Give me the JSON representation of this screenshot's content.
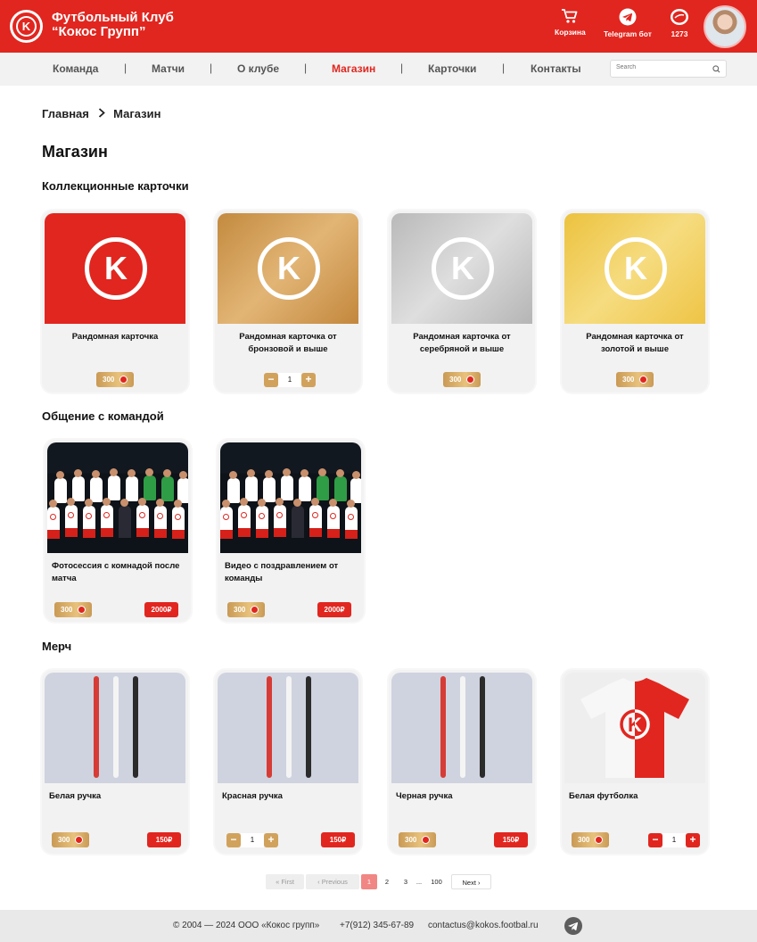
{
  "header": {
    "club_line1": "Футбольный Клуб",
    "club_line2": "“Кокос Групп”",
    "logo_letter": "K",
    "cart_label": "Корзина",
    "telegram_label": "Telegram бот",
    "coins_label": "1273"
  },
  "nav": {
    "items": [
      "Команда",
      "Матчи",
      "О клубе",
      "Магазин",
      "Карточки",
      "Контакты"
    ],
    "active": "Магазин",
    "separator": "|",
    "search_placeholder": "Search"
  },
  "breadcrumb": {
    "home": "Главная",
    "current": "Магазин"
  },
  "page_title": "Магазин",
  "sections": {
    "cards": "Коллекционные карточки",
    "team": "Общение с командой",
    "merch": "Мерч"
  },
  "collectible_cards": [
    {
      "name": "Рандомная карточка",
      "coins": "300",
      "color": "#e1261f"
    },
    {
      "name": "Рандомная карточка от бронзовой и выше",
      "quantity": "1",
      "color": "#c98f45"
    },
    {
      "name": "Рандомная карточка от серебряной и выше",
      "coins": "300",
      "color": "#bdbdbd"
    },
    {
      "name": "Рандомная карточка от золотой и выше",
      "coins": "300",
      "color": "#eec747"
    }
  ],
  "team_items": [
    {
      "name": "Фотосессия с комнадой после матча",
      "coins": "300",
      "price": "2000₽"
    },
    {
      "name": "Видео с поздравлением от команды",
      "coins": "300",
      "price": "2000₽"
    }
  ],
  "merch_items": [
    {
      "name": "Белая ручка",
      "coins": "300",
      "price": "150₽"
    },
    {
      "name": "Красная ручка",
      "quantity": "1",
      "price": "150₽"
    },
    {
      "name": "Черная ручка",
      "coins": "300",
      "price": "150₽"
    },
    {
      "name": "Белая футболка",
      "coins": "300",
      "quantity": "1"
    }
  ],
  "stepper": {
    "minus": "−",
    "plus": "+"
  },
  "pagination": {
    "first": "First",
    "previous": "Previous",
    "pages": [
      "1",
      "2",
      "3"
    ],
    "ellipsis": "...",
    "last_page": "100",
    "next": "Next",
    "current": "1"
  },
  "footer": {
    "copyright": "© 2004 — 2024 ООО «Кокос групп»",
    "phone": "+7(912) 345-67-89",
    "email": "contactus@kokos.footbal.ru"
  },
  "icons": [
    "cart-icon",
    "telegram-icon",
    "coin-icon",
    "search-icon",
    "chevron-right-icon",
    "double-chevron-left-icon",
    "chevron-left-icon"
  ],
  "colors": {
    "brand_red": "#e1261f",
    "gold": "#d1a25c",
    "nav_bg": "#f2f2f2"
  }
}
